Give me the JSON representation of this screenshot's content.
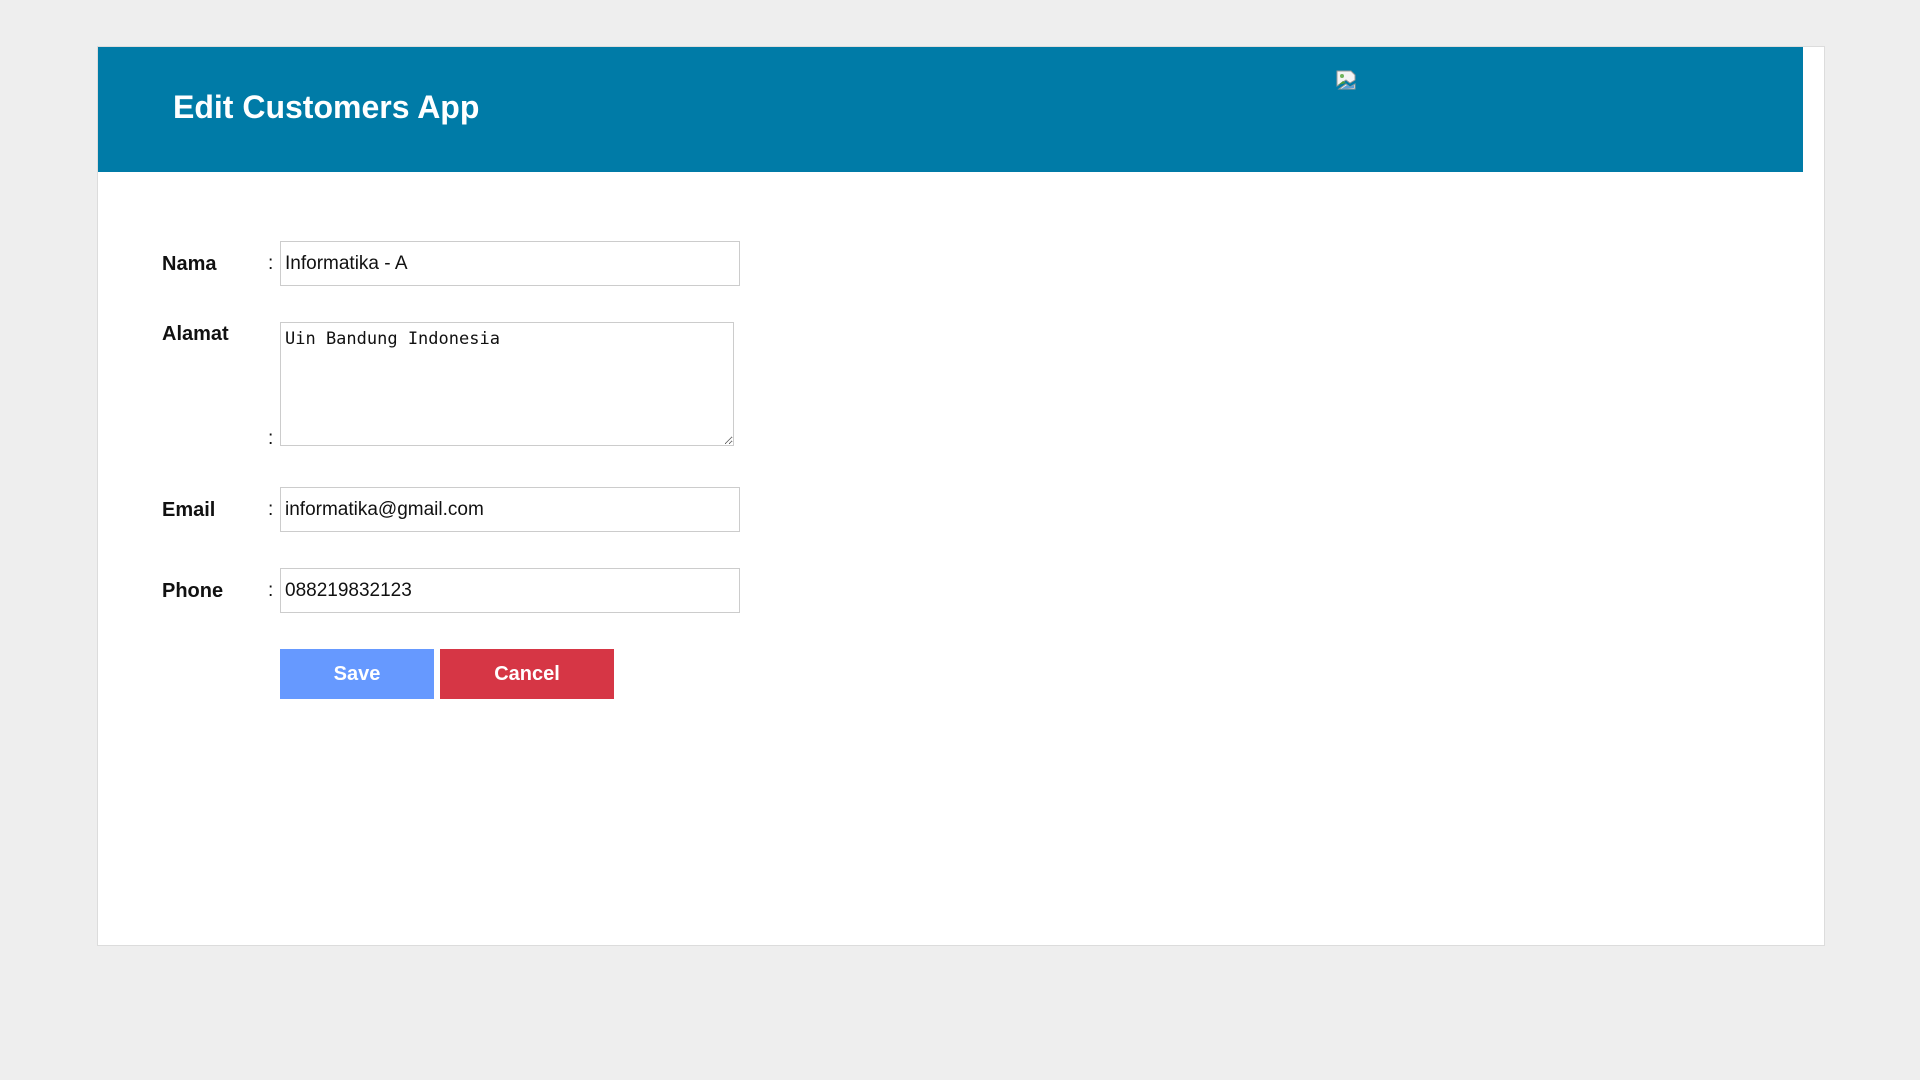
{
  "app": {
    "title": "Edit Customers App"
  },
  "header": {
    "logo_icon": "broken-image-icon",
    "background_color": "#007ba7"
  },
  "form": {
    "separator": ":",
    "nama": {
      "label": "Nama",
      "value": "Informatika - A"
    },
    "alamat": {
      "label": "Alamat",
      "value": "Uin Bandung Indonesia"
    },
    "email": {
      "label": "Email",
      "value": "informatika@gmail.com"
    },
    "phone": {
      "label": "Phone",
      "value": "088219832123"
    }
  },
  "buttons": {
    "save_label": "Save",
    "cancel_label": "Cancel",
    "save_color": "#6699ff",
    "cancel_color": "#d63645"
  }
}
